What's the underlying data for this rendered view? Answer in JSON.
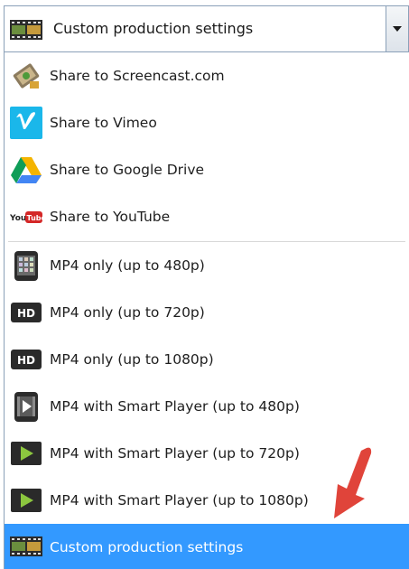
{
  "combo": {
    "selected_label": "Custom production settings",
    "icon": "film-strip-icon"
  },
  "menu": {
    "items": [
      {
        "label": "Share to Screencast.com",
        "icon": "screencast-icon"
      },
      {
        "label": "Share to Vimeo",
        "icon": "vimeo-icon"
      },
      {
        "label": "Share to Google Drive",
        "icon": "google-drive-icon"
      },
      {
        "label": "Share to YouTube",
        "icon": "youtube-icon"
      },
      {
        "label": "MP4 only (up to 480p)",
        "icon": "phone-icon"
      },
      {
        "label": "MP4 only (up to 720p)",
        "icon": "hd-icon",
        "icon_text": "HD"
      },
      {
        "label": "MP4 only (up to 1080p)",
        "icon": "hd-icon",
        "icon_text": "HD"
      },
      {
        "label": "MP4 with Smart Player (up to 480p)",
        "icon": "phone-play-icon"
      },
      {
        "label": "MP4 with Smart Player (up to 720p)",
        "icon": "play-icon"
      },
      {
        "label": "MP4 with Smart Player (up to 1080p)",
        "icon": "play-icon"
      },
      {
        "label": "Custom production settings",
        "icon": "film-strip-icon",
        "selected": true
      }
    ]
  },
  "colors": {
    "selection": "#3399ff",
    "annotation_arrow": "#e0443a"
  }
}
